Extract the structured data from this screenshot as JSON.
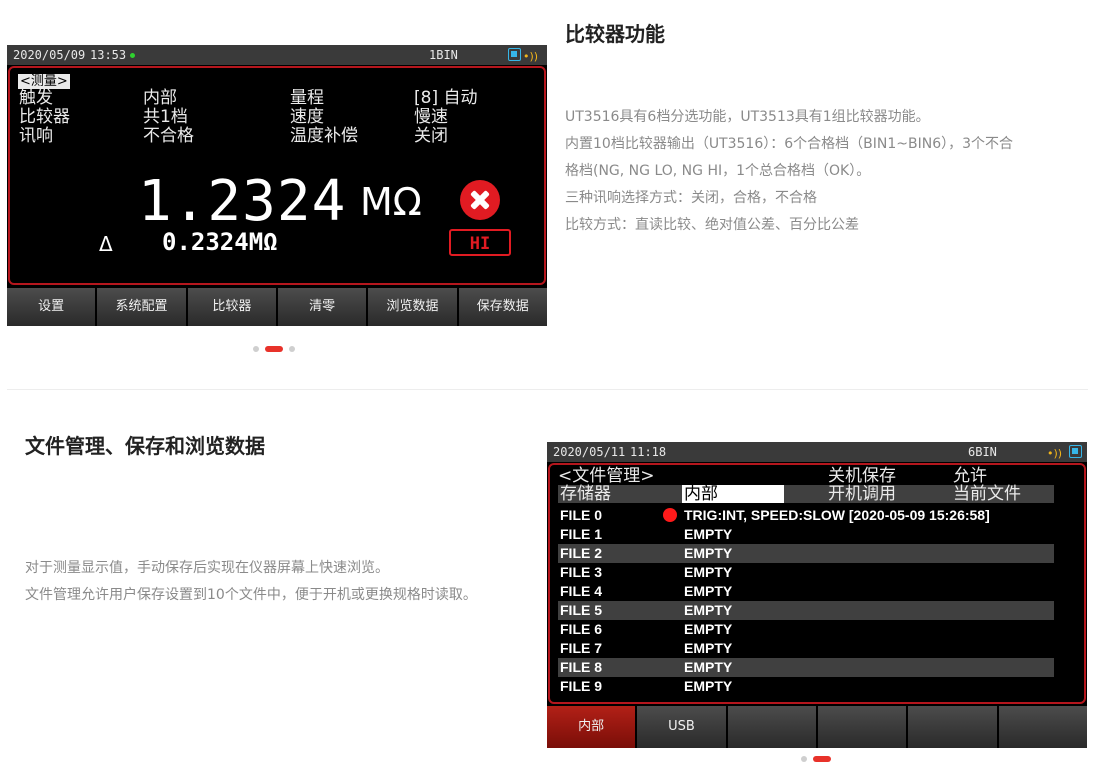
{
  "section1": {
    "title": "比较器功能",
    "desc": [
      "UT3516具有6档分选功能，UT3513具有1组比较器功能。",
      "内置10档比较器输出（UT3516）：6个合格档（BIN1~BIN6），3个不合",
      "格档(NG, NG LO, NG HI，1个总合格档（OK）。",
      "三种讯响选择方式：关闭，合格，不合格",
      "比较方式：直读比较、绝对值公差、百分比公差"
    ],
    "screen": {
      "date": "2020/05/09",
      "time": "13:53",
      "bin": "1BIN",
      "tag": "<测量>",
      "params": [
        {
          "label": "触发",
          "value": "内部",
          "label2": "量程",
          "value2": "[8] 自动"
        },
        {
          "label": "比较器",
          "value": "共1档",
          "label2": "速度",
          "value2": "慢速"
        },
        {
          "label": "讯响",
          "value": "不合格",
          "label2": "温度补偿",
          "value2": "关闭"
        }
      ],
      "main_value": "1.2324",
      "main_unit": "MΩ",
      "delta_symbol": "Δ",
      "delta_value": "0.2324MΩ",
      "status_badge": "HI",
      "softkeys": [
        "设置",
        "系统配置",
        "比较器",
        "清零",
        "浏览数据",
        "保存数据"
      ]
    },
    "carousel": {
      "count": 3,
      "active": 1
    }
  },
  "section2": {
    "title": "文件管理、保存和浏览数据",
    "desc": [
      "对于测量显示值，手动保存后实现在仪器屏幕上快速浏览。",
      "文件管理允许用户保存设置到10个文件中，便于开机或更换规格时读取。"
    ],
    "screen": {
      "date": "2020/05/11",
      "time": "11:18",
      "bin": "6BIN",
      "tag": "<文件管理>",
      "power_save_label": "关机保存",
      "power_save_value": "允许",
      "storage_label": "存储器",
      "storage_value": "内部",
      "power_on_label": "开机调用",
      "power_on_value": "当前文件",
      "files": [
        {
          "name": "FILE 0",
          "value": "TRIG:INT, SPEED:SLOW  [2020-05-09  15:26:58]",
          "has_dot": true
        },
        {
          "name": "FILE 1",
          "value": "EMPTY"
        },
        {
          "name": "FILE 2",
          "value": "EMPTY"
        },
        {
          "name": "FILE 3",
          "value": "EMPTY"
        },
        {
          "name": "FILE 4",
          "value": "EMPTY"
        },
        {
          "name": "FILE 5",
          "value": "EMPTY"
        },
        {
          "name": "FILE 6",
          "value": "EMPTY"
        },
        {
          "name": "FILE 7",
          "value": "EMPTY"
        },
        {
          "name": "FILE 8",
          "value": "EMPTY"
        },
        {
          "name": "FILE 9",
          "value": "EMPTY"
        }
      ],
      "softkeys": [
        "内部",
        "USB",
        "",
        "",
        "",
        ""
      ],
      "active_softkey": 0
    },
    "carousel": {
      "count": 2,
      "active": 1
    }
  },
  "colors": {
    "accent": "#e8322a",
    "panel_border": "#b5161d",
    "status_green": "#2fd12f",
    "usb_blue": "#36b6e8"
  }
}
